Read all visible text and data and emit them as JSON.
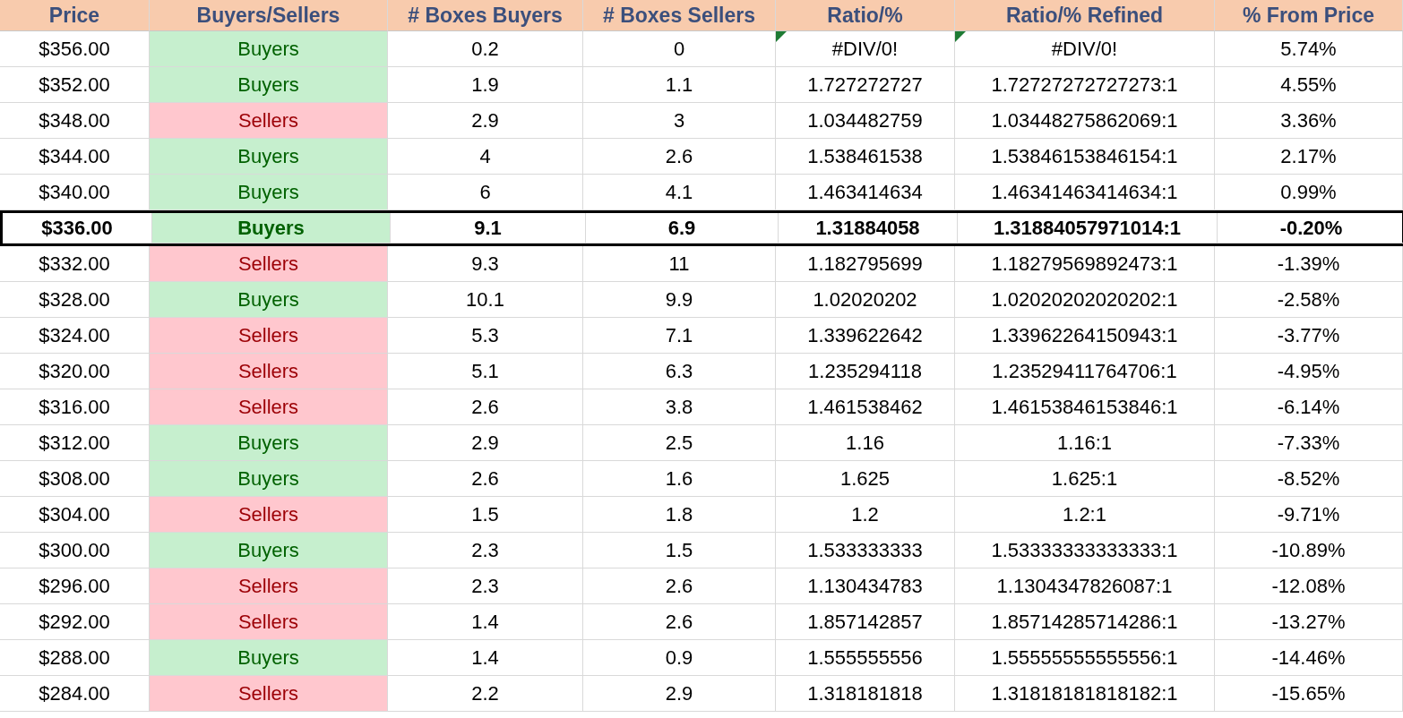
{
  "table": {
    "columns": [
      "Price",
      "Buyers/Sellers",
      "# Boxes Buyers",
      "# Boxes Sellers",
      "Ratio/%",
      "Ratio/% Refined",
      "% From Price"
    ],
    "rows": [
      {
        "price": "$356.00",
        "side": "Buyers",
        "kind": "buyers",
        "boxes_buyers": "0.2",
        "boxes_sellers": "0",
        "ratio": "#DIV/0!",
        "ratio_refined": "#DIV/0!",
        "from_price": "5.74%",
        "error_flag": true,
        "selected": false
      },
      {
        "price": "$352.00",
        "side": "Buyers",
        "kind": "buyers",
        "boxes_buyers": "1.9",
        "boxes_sellers": "1.1",
        "ratio": "1.727272727",
        "ratio_refined": "1.72727272727273:1",
        "from_price": "4.55%",
        "error_flag": false,
        "selected": false
      },
      {
        "price": "$348.00",
        "side": "Sellers",
        "kind": "sellers",
        "boxes_buyers": "2.9",
        "boxes_sellers": "3",
        "ratio": "1.034482759",
        "ratio_refined": "1.03448275862069:1",
        "from_price": "3.36%",
        "error_flag": false,
        "selected": false
      },
      {
        "price": "$344.00",
        "side": "Buyers",
        "kind": "buyers",
        "boxes_buyers": "4",
        "boxes_sellers": "2.6",
        "ratio": "1.538461538",
        "ratio_refined": "1.53846153846154:1",
        "from_price": "2.17%",
        "error_flag": false,
        "selected": false
      },
      {
        "price": "$340.00",
        "side": "Buyers",
        "kind": "buyers",
        "boxes_buyers": "6",
        "boxes_sellers": "4.1",
        "ratio": "1.463414634",
        "ratio_refined": "1.46341463414634:1",
        "from_price": "0.99%",
        "error_flag": false,
        "selected": false
      },
      {
        "price": "$336.00",
        "side": "Buyers",
        "kind": "buyers",
        "boxes_buyers": "9.1",
        "boxes_sellers": "6.9",
        "ratio": "1.31884058",
        "ratio_refined": "1.31884057971014:1",
        "from_price": "-0.20%",
        "error_flag": false,
        "selected": true
      },
      {
        "price": "$332.00",
        "side": "Sellers",
        "kind": "sellers",
        "boxes_buyers": "9.3",
        "boxes_sellers": "11",
        "ratio": "1.182795699",
        "ratio_refined": "1.18279569892473:1",
        "from_price": "-1.39%",
        "error_flag": false,
        "selected": false
      },
      {
        "price": "$328.00",
        "side": "Buyers",
        "kind": "buyers",
        "boxes_buyers": "10.1",
        "boxes_sellers": "9.9",
        "ratio": "1.02020202",
        "ratio_refined": "1.02020202020202:1",
        "from_price": "-2.58%",
        "error_flag": false,
        "selected": false
      },
      {
        "price": "$324.00",
        "side": "Sellers",
        "kind": "sellers",
        "boxes_buyers": "5.3",
        "boxes_sellers": "7.1",
        "ratio": "1.339622642",
        "ratio_refined": "1.33962264150943:1",
        "from_price": "-3.77%",
        "error_flag": false,
        "selected": false
      },
      {
        "price": "$320.00",
        "side": "Sellers",
        "kind": "sellers",
        "boxes_buyers": "5.1",
        "boxes_sellers": "6.3",
        "ratio": "1.235294118",
        "ratio_refined": "1.23529411764706:1",
        "from_price": "-4.95%",
        "error_flag": false,
        "selected": false
      },
      {
        "price": "$316.00",
        "side": "Sellers",
        "kind": "sellers",
        "boxes_buyers": "2.6",
        "boxes_sellers": "3.8",
        "ratio": "1.461538462",
        "ratio_refined": "1.46153846153846:1",
        "from_price": "-6.14%",
        "error_flag": false,
        "selected": false
      },
      {
        "price": "$312.00",
        "side": "Buyers",
        "kind": "buyers",
        "boxes_buyers": "2.9",
        "boxes_sellers": "2.5",
        "ratio": "1.16",
        "ratio_refined": "1.16:1",
        "from_price": "-7.33%",
        "error_flag": false,
        "selected": false
      },
      {
        "price": "$308.00",
        "side": "Buyers",
        "kind": "buyers",
        "boxes_buyers": "2.6",
        "boxes_sellers": "1.6",
        "ratio": "1.625",
        "ratio_refined": "1.625:1",
        "from_price": "-8.52%",
        "error_flag": false,
        "selected": false
      },
      {
        "price": "$304.00",
        "side": "Sellers",
        "kind": "sellers",
        "boxes_buyers": "1.5",
        "boxes_sellers": "1.8",
        "ratio": "1.2",
        "ratio_refined": "1.2:1",
        "from_price": "-9.71%",
        "error_flag": false,
        "selected": false
      },
      {
        "price": "$300.00",
        "side": "Buyers",
        "kind": "buyers",
        "boxes_buyers": "2.3",
        "boxes_sellers": "1.5",
        "ratio": "1.533333333",
        "ratio_refined": "1.53333333333333:1",
        "from_price": "-10.89%",
        "error_flag": false,
        "selected": false
      },
      {
        "price": "$296.00",
        "side": "Sellers",
        "kind": "sellers",
        "boxes_buyers": "2.3",
        "boxes_sellers": "2.6",
        "ratio": "1.130434783",
        "ratio_refined": "1.1304347826087:1",
        "from_price": "-12.08%",
        "error_flag": false,
        "selected": false
      },
      {
        "price": "$292.00",
        "side": "Sellers",
        "kind": "sellers",
        "boxes_buyers": "1.4",
        "boxes_sellers": "2.6",
        "ratio": "1.857142857",
        "ratio_refined": "1.85714285714286:1",
        "from_price": "-13.27%",
        "error_flag": false,
        "selected": false
      },
      {
        "price": "$288.00",
        "side": "Buyers",
        "kind": "buyers",
        "boxes_buyers": "1.4",
        "boxes_sellers": "0.9",
        "ratio": "1.555555556",
        "ratio_refined": "1.55555555555556:1",
        "from_price": "-14.46%",
        "error_flag": false,
        "selected": false
      },
      {
        "price": "$284.00",
        "side": "Sellers",
        "kind": "sellers",
        "boxes_buyers": "2.2",
        "boxes_sellers": "2.9",
        "ratio": "1.318181818",
        "ratio_refined": "1.31818181818182:1",
        "from_price": "-15.65%",
        "error_flag": false,
        "selected": false
      }
    ]
  }
}
